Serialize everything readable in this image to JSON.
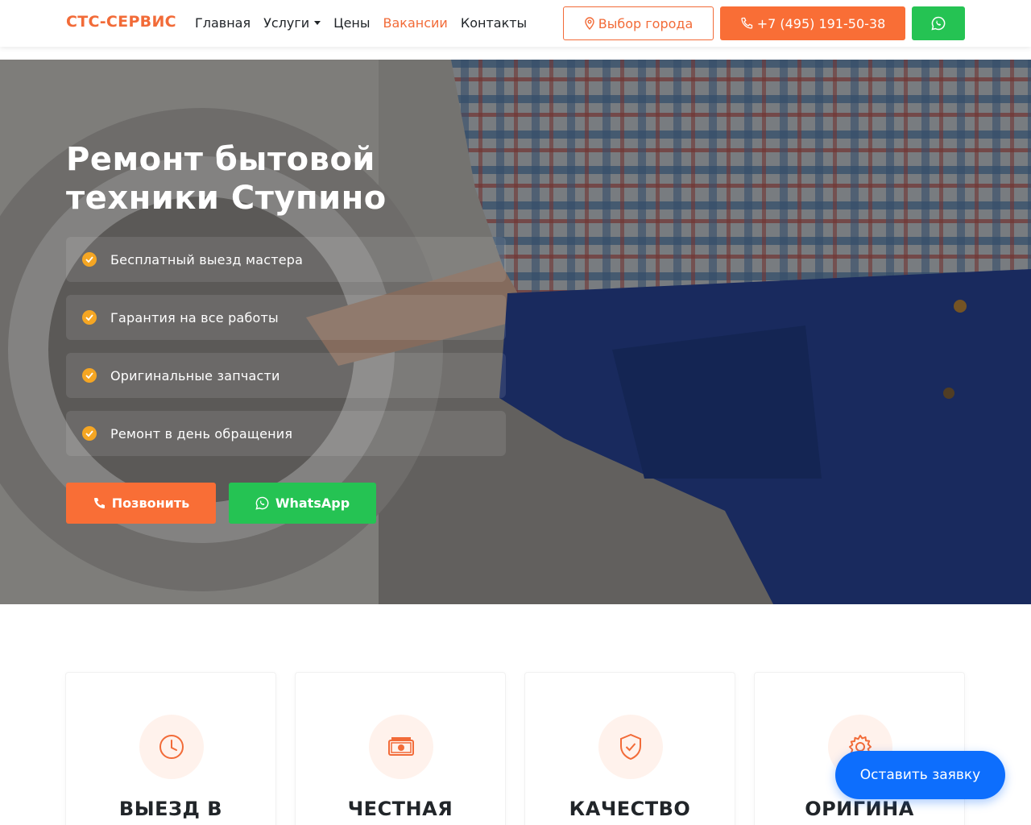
{
  "brand": "СТС-СЕРВИС",
  "nav": {
    "items": [
      {
        "label": "Главная"
      },
      {
        "label": "Услуги"
      },
      {
        "label": "Цены"
      },
      {
        "label": "Вакансии"
      },
      {
        "label": "Контакты"
      }
    ],
    "city_button": "Выбор города",
    "phone_button": "+7 (495) 191-50-38",
    "whatsapp_icon": "whatsapp-icon"
  },
  "hero": {
    "title": "Ремонт бытовой техники Ступино",
    "features": [
      "Бесплатный выезд мастера",
      "Гарантия на все работы",
      "Оригинальные запчасти",
      "Ремонт в день обращения"
    ],
    "call_button": "Позвонить",
    "whatsapp_button": "WhatsApp"
  },
  "benefits": [
    {
      "icon": "clock-icon",
      "title": "ВЫЕЗД В"
    },
    {
      "icon": "money-icon",
      "title": "ЧЕСТНАЯ"
    },
    {
      "icon": "shield-check-icon",
      "title": "КАЧЕСТВО"
    },
    {
      "icon": "gear-icon",
      "title": "ОРИГИНА"
    }
  ],
  "floating_button": "Оставить заявку",
  "colors": {
    "accent": "#f96e36",
    "whatsapp": "#25c353",
    "floating": "#0d6efd",
    "check": "#f5a623"
  }
}
